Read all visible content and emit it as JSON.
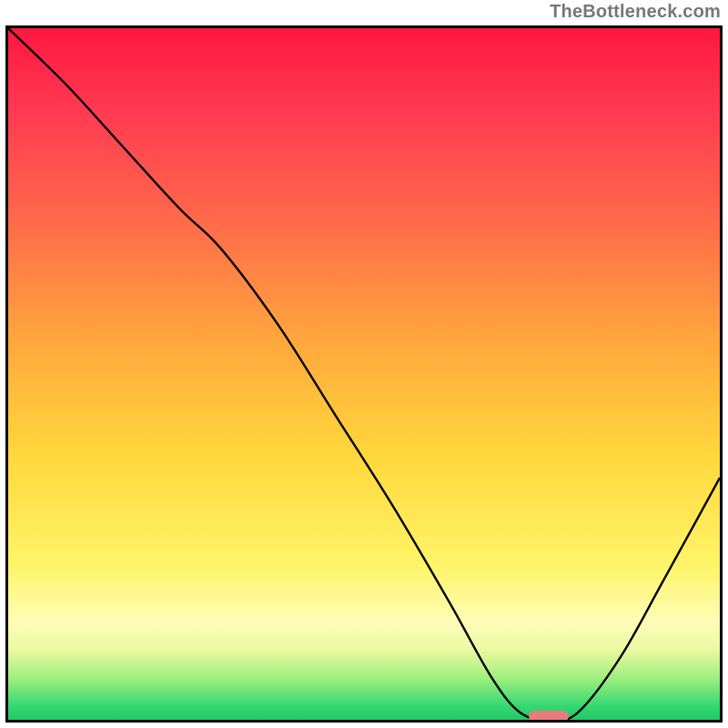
{
  "watermark": "TheBottleneck.com",
  "colors": {
    "gradient_top": "#ff1740",
    "gradient_mid_orange": "#ffa93d",
    "gradient_mid_yellow": "#fff56a",
    "gradient_bottom": "#22c768",
    "curve": "#000000",
    "pill": "#e97a7d",
    "frame": "#000000"
  },
  "chart_data": {
    "type": "line",
    "title": "",
    "xlabel": "",
    "ylabel": "",
    "xlim": [
      0,
      100
    ],
    "ylim": [
      0,
      100
    ],
    "series": [
      {
        "name": "bottleneck-curve",
        "x": [
          0,
          8,
          16,
          24,
          30,
          38,
          46,
          54,
          62,
          68,
          72,
          76,
          80,
          86,
          92,
          100
        ],
        "y": [
          100,
          92,
          83,
          74,
          68,
          57,
          44,
          31,
          17,
          6,
          1,
          0,
          1,
          9,
          20,
          35
        ]
      }
    ],
    "annotations": [
      {
        "name": "optimal-marker",
        "x": 76,
        "y": 0.5,
        "shape": "pill",
        "color": "#e97a7d"
      }
    ],
    "background_gradient_stops": [
      {
        "pos": 0.0,
        "color": "#ff1740"
      },
      {
        "pos": 0.28,
        "color": "#ff6a4a"
      },
      {
        "pos": 0.46,
        "color": "#ffa93d"
      },
      {
        "pos": 0.78,
        "color": "#fff56a"
      },
      {
        "pos": 0.94,
        "color": "#9eee7d"
      },
      {
        "pos": 1.0,
        "color": "#22c768"
      }
    ]
  }
}
